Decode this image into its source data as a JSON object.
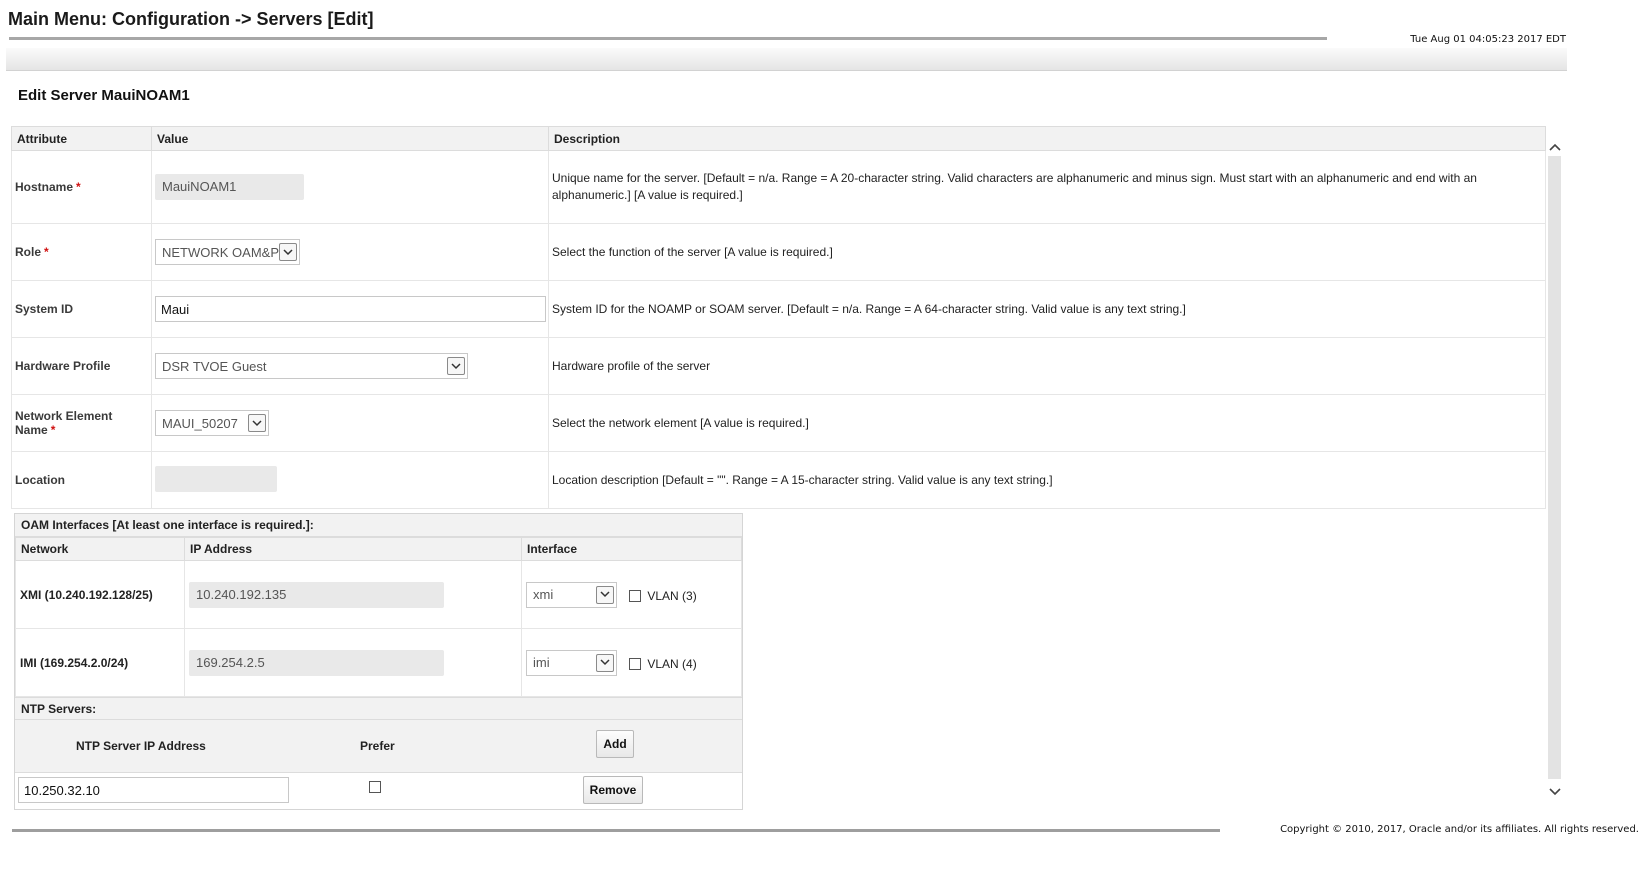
{
  "header": {
    "title": "Main Menu: Configuration -> Servers [Edit]",
    "timestamp": "Tue Aug 01 04:05:23 2017 EDT"
  },
  "form": {
    "title": "Edit Server MauiNOAM1",
    "columns": {
      "attribute": "Attribute",
      "value": "Value",
      "description": "Description"
    },
    "rows": {
      "hostname": {
        "label": "Hostname",
        "required_mark": "*",
        "value": "MauiNOAM1",
        "description": "Unique name for the server. [Default = n/a. Range = A 20-character string. Valid characters are alphanumeric and minus sign. Must start with an alphanumeric and end with an alphanumeric.] [A value is required.]"
      },
      "role": {
        "label": "Role",
        "required_mark": "*",
        "value": "NETWORK OAM&P",
        "description": "Select the function of the server [A value is required.]"
      },
      "system_id": {
        "label": "System ID",
        "value": "Maui",
        "description": "System ID for the NOAMP or SOAM server. [Default = n/a. Range = A 64-character string. Valid value is any text string.]"
      },
      "hardware_profile": {
        "label": "Hardware Profile",
        "value": "DSR TVOE Guest",
        "description": "Hardware profile of the server"
      },
      "network_element": {
        "label": "Network Element Name",
        "required_mark": "*",
        "value": "MAUI_50207",
        "description": "Select the network element [A value is required.]"
      },
      "location": {
        "label": "Location",
        "value": "",
        "description": "Location description [Default = \"\". Range = A 15-character string. Valid value is any text string.]"
      }
    }
  },
  "oam": {
    "title": "OAM Interfaces [At least one interface is required.]:",
    "columns": {
      "network": "Network",
      "ip": "IP Address",
      "interface": "Interface"
    },
    "rows": [
      {
        "network": "XMI (10.240.192.128/25)",
        "ip": "10.240.192.135",
        "interface": "xmi",
        "vlan": "VLAN (3)",
        "vlan_checked": false
      },
      {
        "network": "IMI (169.254.2.0/24)",
        "ip": "169.254.2.5",
        "interface": "imi",
        "vlan": "VLAN (4)",
        "vlan_checked": false
      }
    ]
  },
  "ntp": {
    "title": "NTP Servers:",
    "col_ip": "NTP Server IP Address",
    "col_prefer": "Prefer",
    "add_label": "Add",
    "entry_ip": "10.250.32.10",
    "entry_prefer_checked": false,
    "remove_label": "Remove"
  },
  "footer": {
    "copyright": "Copyright © 2010, 2017, Oracle and/or its affiliates. All rights reserved."
  },
  "icons": {
    "dropdown": "chevron-down-icon",
    "scroll_up": "chevron-up-icon",
    "scroll_down": "chevron-down-icon"
  }
}
